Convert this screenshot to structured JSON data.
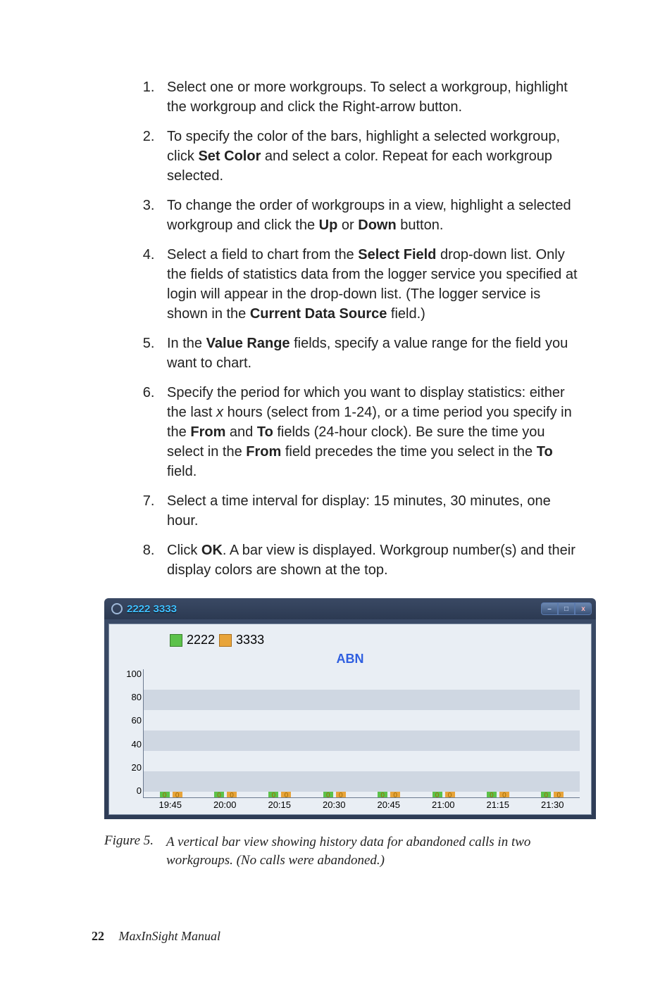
{
  "steps": [
    "Select one or more workgroups. To select a workgroup, highlight the workgroup and click the Right-arrow button.",
    "To specify the color of the bars, highlight a selected workgroup, click <b>Set Color</b> and select a color. Repeat for each workgroup selected.",
    "To change the order of workgroups in a view, highlight a selected workgroup and click the <b>Up</b> or <b>Down</b> button.",
    "Select a field to chart from the <b>Select Field</b> drop-down list. Only the fields of statistics data from the logger service you specified at login will appear in the drop-down list. (The logger service is shown in the <b>Current Data Source</b> field.)",
    "In the <b>Value Range</b> fields, specify a value range for the field you want to chart.",
    "Specify the period for which you want to display statistics: either the last <em class='i'>x</em> hours (select from 1-24), or a time period you specify in the <b>From</b> and <b>To</b> fields (24-hour clock). Be sure the time you select in the <b>From</b> field precedes the time you select in the <b>To</b> field.",
    "Select a time interval for display: 15 minutes, 30 minutes, one hour.",
    "Click <b>OK</b>. A bar view is displayed. Workgroup number(s) and their display colors are shown at the top."
  ],
  "window": {
    "title": "2222 3333",
    "min": "–",
    "max": "□",
    "close": "x"
  },
  "legend": {
    "a": "2222",
    "b": "3333"
  },
  "colors": {
    "a": "#5cc24a",
    "b": "#e8a43a"
  },
  "chart_data": {
    "type": "bar",
    "title": "ABN",
    "xlabel": "",
    "ylabel": "",
    "ylim": [
      0,
      100
    ],
    "yticks": [
      "100",
      "80",
      "60",
      "40",
      "20",
      "0"
    ],
    "categories": [
      "19:45",
      "20:00",
      "20:15",
      "20:30",
      "20:45",
      "21:00",
      "21:15",
      "21:30"
    ],
    "series": [
      {
        "name": "2222",
        "values": [
          0,
          0,
          0,
          0,
          0,
          0,
          0,
          0
        ]
      },
      {
        "name": "3333",
        "values": [
          0,
          0,
          0,
          0,
          0,
          0,
          0,
          0
        ]
      }
    ]
  },
  "caption": {
    "label": "Figure 5.",
    "text": "A vertical bar view showing history data for abandoned calls in two workgroups. (No calls were abandoned.)"
  },
  "footer": {
    "page": "22",
    "doc": "MaxInSight Manual"
  }
}
